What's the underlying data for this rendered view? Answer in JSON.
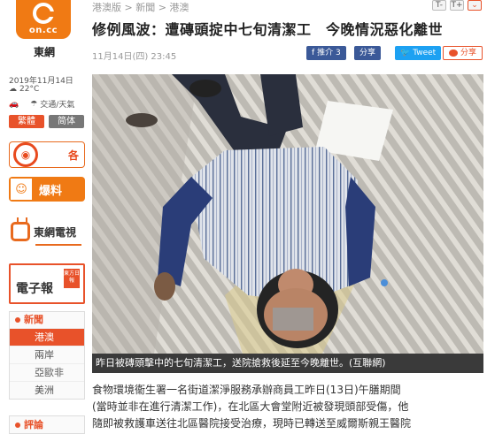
{
  "sidebar": {
    "logo_text": "on.cc",
    "brand": "東網",
    "date": "2019年11月14日",
    "weather": "22°C",
    "traffic_label": "交通/天氣",
    "lang_trad": "繁體",
    "lang_simp": "简体",
    "promos": {
      "radio_label": "各",
      "scoop_label": "爆料",
      "tv_label": "東網電視",
      "epaper_label": "電子報",
      "epaper_badge": "東方日報"
    },
    "nav": {
      "section_title": "新聞",
      "items": [
        "港澳",
        "兩岸",
        "亞歐非",
        "美洲"
      ],
      "active_index": 0,
      "section2_title": "評論"
    }
  },
  "header": {
    "breadcrumb": "港澳版 > 新聞 > 港澳",
    "font_small": "T-",
    "font_large": "T+",
    "headline": "修例風波：遭磚頭掟中七旬清潔工　今晚情況惡化離世",
    "timestamp": "11月14日(四) 23:45"
  },
  "share": {
    "fb_like": "推介 3",
    "fb_share": "分享",
    "tweet": "Tweet",
    "weibo": "分享"
  },
  "article": {
    "caption": "昨日被磚頭擊中的七旬清潔工，送院搶救後延至今晚離世。(互聯網)",
    "paragraphs": [
      "食物環境衞生署一名街道潔淨服務承辦商員工昨日(13日)午膳期間",
      "(當時並非在進行清潔工作)，在北區大會堂附近被發現頭部受傷，他",
      "隨即被救護車送往北區醫院接受治療，現時已轉送至威爾斯親王醫院"
    ]
  },
  "colors": {
    "brand_orange": "#f07a14",
    "accent_red": "#e8522a",
    "facebook": "#3b5998",
    "twitter": "#1da1f2"
  }
}
